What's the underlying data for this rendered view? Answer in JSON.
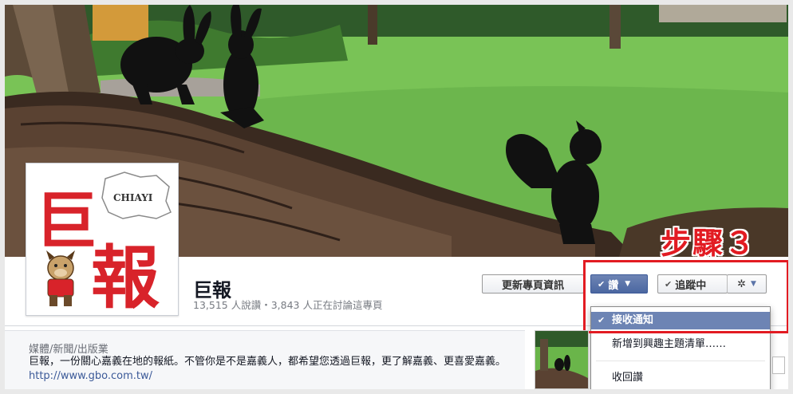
{
  "cover": {
    "annotation": "步驟３"
  },
  "page": {
    "title": "巨報",
    "stats": "13,515 人說讚・3,843 人正在討論這專頁"
  },
  "profile": {
    "logo_text_main": "巨",
    "logo_text_secondary": "報",
    "map_label": "CHIAYI"
  },
  "actions": {
    "update_info_label": "更新專頁資訊",
    "like_label": "讚",
    "following_label": "追蹤中"
  },
  "dropdown": {
    "items": [
      {
        "label": "接收通知",
        "selected": true
      },
      {
        "label": "新增到興趣主題清單……",
        "selected": false
      },
      {
        "label": "收回讚",
        "selected": false
      }
    ]
  },
  "about": {
    "category": "媒體/新聞/出版業",
    "description": "巨報，一份關心嘉義在地的報紙。不管你是不是嘉義人，都希望您透過巨報，更了解嘉義、更喜愛嘉義。",
    "link": "http://www.gbo.com.tw/"
  },
  "colors": {
    "facebook_blue": "#3b5998",
    "like_button": "#5b74a8",
    "annotation_red": "#e21b22"
  }
}
